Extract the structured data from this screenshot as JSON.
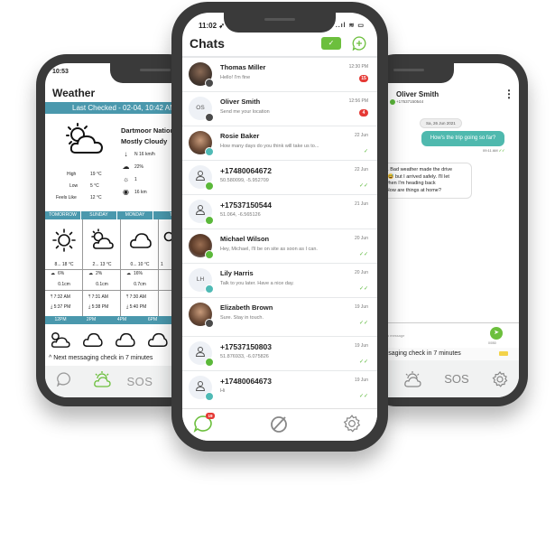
{
  "weather_screen": {
    "status_time": "10:53",
    "title": "Weather",
    "last_checked": "Last Checked - 02-04, 10:42 AM",
    "location": "Dartmoor National Park",
    "condition": "Mostly Cloudy",
    "wind": "N 16 km/h",
    "cloud_cover": "22%",
    "uv_index": "1",
    "visibility": "16 km",
    "high_label": "High",
    "high_value": "19 °C",
    "low_label": "Low",
    "low_value": "5 °C",
    "feels_like_label": "Feels Like",
    "feels_like_value": "12 °C",
    "days": [
      {
        "label": "TOMORROW",
        "icon": "sun-icon",
        "temp": "8... 18 °C",
        "rain_chance": "6%",
        "rain_amount": "0.1cm",
        "sunrise": "7:32 AM",
        "sunset": "5:37 PM"
      },
      {
        "label": "SUNDAY",
        "icon": "partly-cloudy-icon",
        "temp": "2... 13 °C",
        "rain_chance": "2%",
        "rain_amount": "0.1cm",
        "sunrise": "7:31 AM",
        "sunset": "5:38 PM"
      },
      {
        "label": "MONDAY",
        "icon": "cloud-icon",
        "temp": "0... 10 °C",
        "rain_chance": "16%",
        "rain_amount": "0.7cm",
        "sunrise": "7:30 AM",
        "sunset": "5:40 PM"
      },
      {
        "label": "T",
        "icon": "partly-cloudy-icon",
        "temp": "1",
        "rain_chance": "",
        "rain_amount": "",
        "sunrise": "",
        "sunset": ""
      }
    ],
    "hours": [
      "12PM",
      "2PM",
      "4PM",
      "6PM"
    ],
    "next_check": "Next messaging check in 7 minutes",
    "tabs": {
      "chats": "chat-icon",
      "weather": "weather-icon",
      "sos": "SOS"
    }
  },
  "chats_screen": {
    "status_time": "11:02",
    "title": "Chats",
    "status_icons": "..ıl ≋ ▭",
    "chats": [
      {
        "name": "Thomas Miller",
        "preview": "Hello! I'm fine",
        "date": "12:30 PM",
        "unread": "15",
        "avatar": "photo",
        "initials": "",
        "badge": "grey"
      },
      {
        "name": "Oliver Smith",
        "preview": "Send me your location",
        "date": "12:56 PM",
        "unread": "4",
        "avatar": "initials",
        "initials": "OS",
        "badge": "grey"
      },
      {
        "name": "Rosie Baker",
        "preview": "How many days do you think will take us to...",
        "date": "22 Jun",
        "tick": "✓",
        "avatar": "photo",
        "initials": "",
        "badge": "teal"
      },
      {
        "name": "+17480064672",
        "preview": "50.580099, -5.952709",
        "date": "22 Jun",
        "tick": "✓✓",
        "avatar": "person",
        "initials": "",
        "badge": "green"
      },
      {
        "name": "+17537150544",
        "preview": "51.064, -6.565126",
        "date": "21 Jun",
        "tick": "",
        "avatar": "person",
        "initials": "",
        "badge": "green"
      },
      {
        "name": "Michael Wilson",
        "preview": "Hey, Michael, I'll be on site as soon as I can.",
        "date": "20 Jun",
        "tick": "✓✓",
        "avatar": "photo",
        "initials": "",
        "badge": "green"
      },
      {
        "name": "Lily Harris",
        "preview": "Talk to you later. Have a nice day.",
        "date": "20 Jun",
        "tick": "✓✓",
        "avatar": "initials",
        "initials": "LH",
        "badge": "teal"
      },
      {
        "name": "Elizabeth Brown",
        "preview": "Sure. Stay in touch.",
        "date": "19 Jun",
        "tick": "✓✓",
        "avatar": "photo",
        "initials": "",
        "badge": "grey"
      },
      {
        "name": "+17537150803",
        "preview": "51.876933, -6.075826",
        "date": "19 Jun",
        "tick": "✓✓",
        "avatar": "person",
        "initials": "",
        "badge": "green"
      },
      {
        "name": "+17480064673",
        "preview": "Hi",
        "date": "19 Jun",
        "tick": "✓✓",
        "avatar": "person",
        "initials": "",
        "badge": "teal"
      }
    ],
    "tab_badge": "19"
  },
  "conversation_screen": {
    "contact_name": "Oliver Smith",
    "contact_phone": "+17537150544",
    "date_chip": "Sa, 26 Jun 2021",
    "outgoing_message": "How's the trip going so far?",
    "outgoing_time": "09:11 AM",
    "incoming_message": "Okay. Bad weather made the drive exciting 😅 but I arrived safely. I'll let you know when I'm heading back now. How are things at home?",
    "incoming_lines": [
      "okay. Bad weather made the drive",
      "iting 😅 but I arrived safely. I'll let",
      "ow when I'm heading back",
      "ow. How are things at home?"
    ],
    "input_placeholder": "Type a message",
    "char_count": "0/050",
    "next_check": "messaging check in 7 minutes",
    "sos_label": "SOS"
  },
  "colors": {
    "accent_green": "#6cbf3d",
    "teal": "#4a98ad",
    "bubble_teal": "#4fb9ae",
    "unread_red": "#e53935"
  }
}
